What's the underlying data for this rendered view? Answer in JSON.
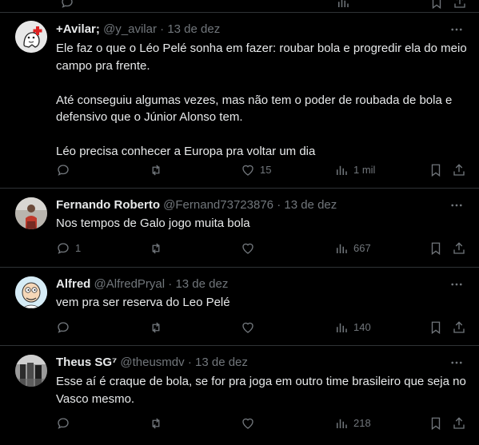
{
  "tweets": [
    {
      "name": "+Avilar;",
      "handle": "@y_avilar",
      "date": "13 de dez",
      "text": "Ele faz o que o Léo Pelé sonha em fazer: roubar bola e progredir ela do meio campo pra frente.\n\nAté conseguiu algumas vezes, mas não tem o poder de roubada de bola e defensivo que o Júnior Alonso tem.\n\nLéo precisa conhecer a Europa pra voltar um dia",
      "replies": "",
      "retweets": "",
      "likes": "15",
      "views": "1 mil"
    },
    {
      "name": "Fernando Roberto",
      "handle": "@Fernand73723876",
      "date": "13 de dez",
      "text": "Nos tempos de Galo jogo muita bola",
      "replies": "1",
      "retweets": "",
      "likes": "",
      "views": "667"
    },
    {
      "name": "Alfred",
      "handle": "@AlfredPryal",
      "date": "13 de dez",
      "text": "vem pra ser reserva do Leo Pelé",
      "replies": "",
      "retweets": "",
      "likes": "",
      "views": "140"
    },
    {
      "name": "Theus SG",
      "badge": "⁷",
      "handle": "@theusmdv",
      "date": "13 de dez",
      "text": "Esse aí é craque de bola, se for pra joga em outro time brasileiro que seja no Vasco mesmo.",
      "replies": "",
      "retweets": "",
      "likes": "",
      "views": "218"
    }
  ],
  "separator": "·",
  "icons": {
    "reply": "reply-icon",
    "retweet": "retweet-icon",
    "like": "heart-icon",
    "views": "views-icon",
    "bookmark": "bookmark-icon",
    "share": "share-icon",
    "more": "more-icon"
  },
  "colors": {
    "background": "#000000",
    "text": "#e7e9ea",
    "muted": "#71767b",
    "divider": "#2f3336"
  }
}
